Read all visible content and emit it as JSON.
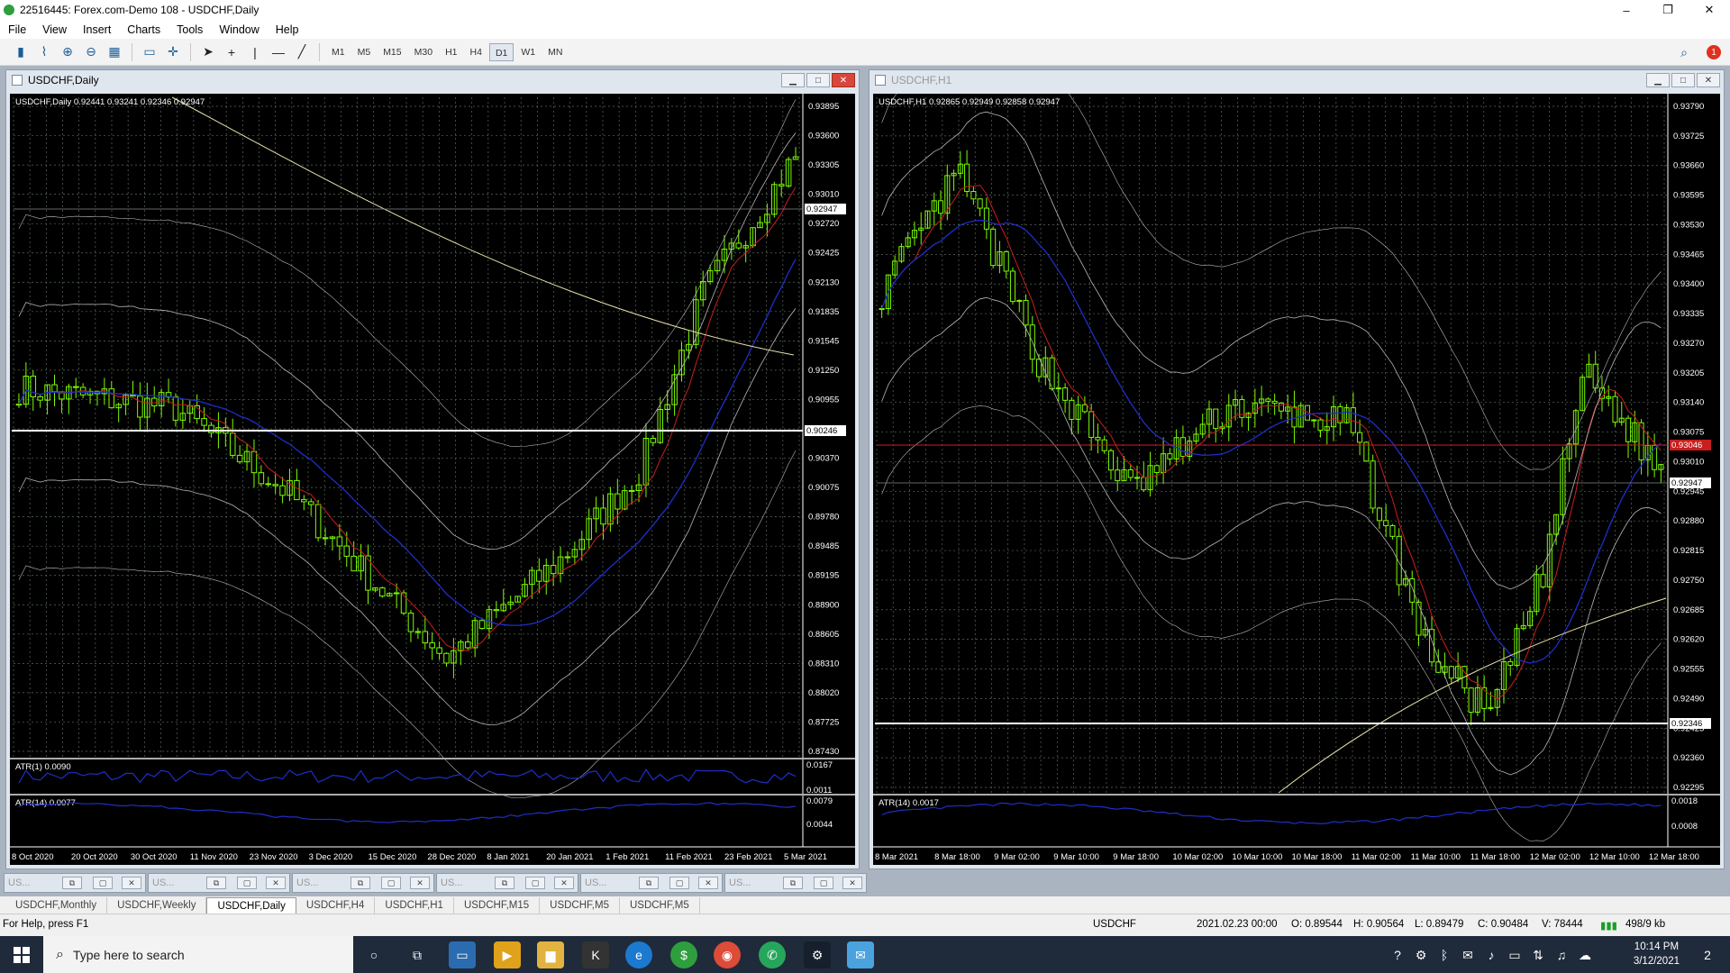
{
  "window": {
    "title": "22516445: Forex.com-Demo 108 - USDCHF,Daily",
    "minimize": "–",
    "restore": "❐",
    "close": "✕"
  },
  "menu": [
    "File",
    "View",
    "Insert",
    "Charts",
    "Tools",
    "Window",
    "Help"
  ],
  "toolbar": {
    "timeframes": [
      "M1",
      "M5",
      "M15",
      "M30",
      "H1",
      "H4",
      "D1",
      "W1",
      "MN"
    ],
    "active_timeframe": "D1",
    "notification_count": "1"
  },
  "charts": [
    {
      "title": "USDCHF,Daily",
      "ohlc_label": "USDCHF,Daily  0.92441 0.93241 0.92346 0.92947",
      "current_price": "0.92947",
      "line_price": "0.90246",
      "sub1_label": "ATR(1) 0.0090",
      "sub2_label": "ATR(14) 0.0077",
      "sub1_ticks": [
        "0.0167",
        "0.0011"
      ],
      "sub2_ticks": [
        "0.0079",
        "0.0044"
      ],
      "price_ticks": [
        "0.93895",
        "0.93600",
        "0.93305",
        "0.93010",
        "0.92720",
        "0.92425",
        "0.92130",
        "0.91835",
        "0.91545",
        "0.91250",
        "0.90955",
        "0.90660",
        "0.90370",
        "0.90075",
        "0.89780",
        "0.89485",
        "0.89195",
        "0.88900",
        "0.88605",
        "0.88310",
        "0.88020",
        "0.87725",
        "0.87430"
      ],
      "time_ticks": [
        "8 Oct 2020",
        "20 Oct 2020",
        "30 Oct 2020",
        "11 Nov 2020",
        "23 Nov 2020",
        "3 Dec 2020",
        "15 Dec 2020",
        "28 Dec 2020",
        "8 Jan 2021",
        "20 Jan 2021",
        "1 Feb 2021",
        "11 Feb 2021",
        "23 Feb 2021",
        "5 Mar 2021"
      ]
    },
    {
      "title": "USDCHF,H1",
      "ohlc_label": "USDCHF,H1  0.92865 0.92949 0.92858 0.92947",
      "current_price": "0.92947",
      "red_price": "0.93046",
      "line_price": "0.92346",
      "sub2_label": "ATR(14) 0.0017",
      "sub2_ticks": [
        "0.0018",
        "0.0008"
      ],
      "price_ticks": [
        "0.93790",
        "0.93725",
        "0.93660",
        "0.93595",
        "0.93530",
        "0.93465",
        "0.93400",
        "0.93335",
        "0.93270",
        "0.93205",
        "0.93140",
        "0.93075",
        "0.93010",
        "0.92945",
        "0.92880",
        "0.92815",
        "0.92750",
        "0.92685",
        "0.92620",
        "0.92555",
        "0.92490",
        "0.92425",
        "0.92360",
        "0.92295"
      ],
      "time_ticks": [
        "8 Mar 2021",
        "8 Mar 18:00",
        "9 Mar 02:00",
        "9 Mar 10:00",
        "9 Mar 18:00",
        "10 Mar 02:00",
        "10 Mar 10:00",
        "10 Mar 18:00",
        "11 Mar 02:00",
        "11 Mar 10:00",
        "11 Mar 18:00",
        "12 Mar 02:00",
        "12 Mar 10:00",
        "12 Mar 18:00"
      ]
    }
  ],
  "minimized": [
    "US...",
    "US...",
    "US...",
    "US...",
    "US...",
    "US..."
  ],
  "tabs": [
    "USDCHF,Monthly",
    "USDCHF,Weekly",
    "USDCHF,Daily",
    "USDCHF,H4",
    "USDCHF,H1",
    "USDCHF,M15",
    "USDCHF,M5",
    "USDCHF,M5"
  ],
  "active_tab": "USDCHF,Daily",
  "status": {
    "help": "For Help, press F1",
    "symbol": "USDCHF",
    "datetime": "2021.02.23 00:00",
    "open": "O: 0.89544",
    "high": "H: 0.90564",
    "low": "L: 0.89479",
    "close": "C: 0.90484",
    "volume": "V: 78444",
    "traffic": "498/9 kb"
  },
  "taskbar": {
    "search_placeholder": "Type here to search",
    "time": "10:14 PM",
    "date": "3/12/2021",
    "notif_count": "2"
  },
  "colors": {
    "bull": "#7cfc00",
    "background": "#000000",
    "grid": "#5a6b5a",
    "ma_red": "#c81e1e",
    "ma_blue": "#1e2ec8",
    "band": "#b8b8b8",
    "trend": "#e8e0a8"
  }
}
